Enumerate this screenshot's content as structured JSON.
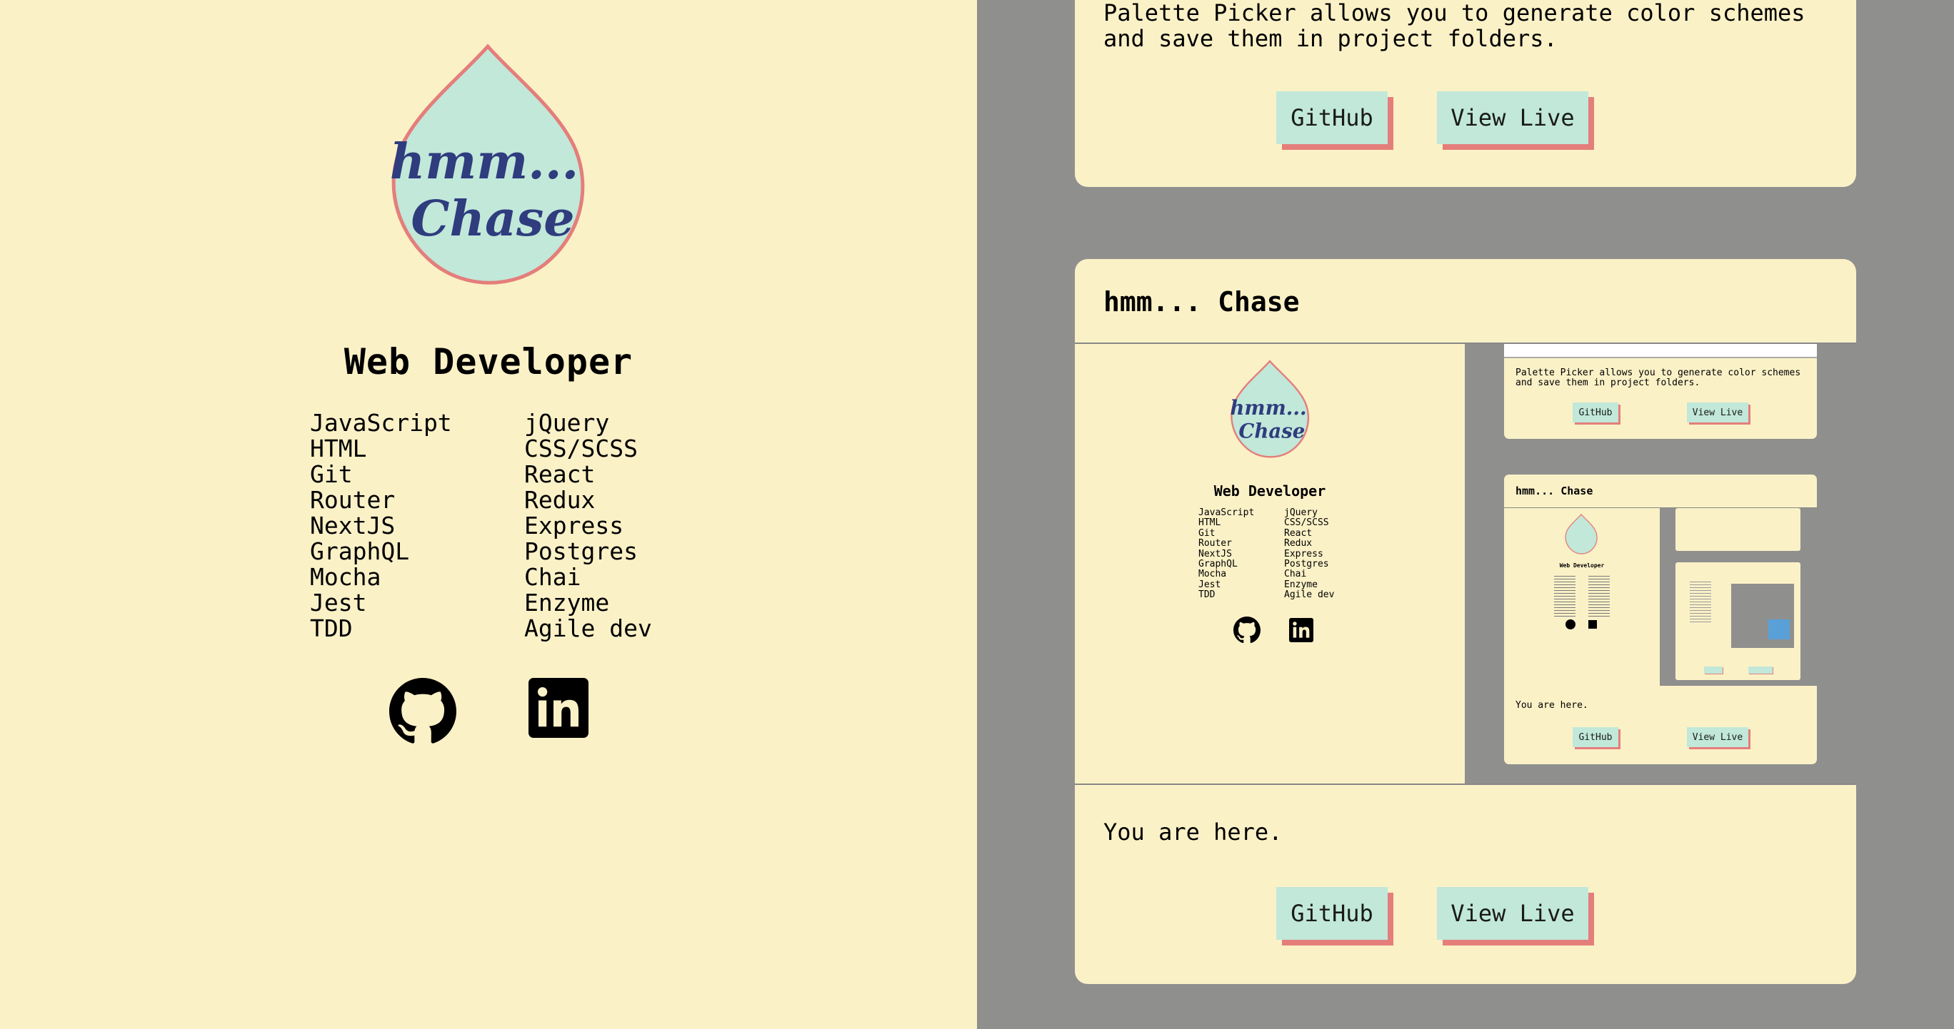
{
  "profile": {
    "logo_line1": "hmm...",
    "logo_line2": "Chase",
    "title": "Web Developer",
    "skills_col1": [
      "JavaScript",
      "HTML",
      "Git",
      "Router",
      "NextJS",
      "GraphQL",
      "Mocha",
      "Jest",
      "TDD"
    ],
    "skills_col2": [
      "jQuery",
      "CSS/SCSS",
      "React",
      "Redux",
      "Express",
      "Postgres",
      "Chai",
      "Enzyme",
      "Agile dev"
    ],
    "github_icon": "github-icon",
    "linkedin_icon": "linkedin-icon"
  },
  "projects": [
    {
      "description": "Palette Picker allows you to generate color schemes and save them in project folders.",
      "github_label": "GitHub",
      "live_label": "View Live"
    },
    {
      "name": "hmm... Chase",
      "description": "You are here.",
      "github_label": "GitHub",
      "live_label": "View Live"
    }
  ],
  "colors": {
    "background": "#fbf1c7",
    "panel": "#8f8f8e",
    "button": "#c1e8d9",
    "button_shadow": "#e47e7b",
    "logo_fill": "#c1e8d9",
    "logo_stroke": "#e47e7b",
    "logo_text": "#2f3c7e"
  }
}
